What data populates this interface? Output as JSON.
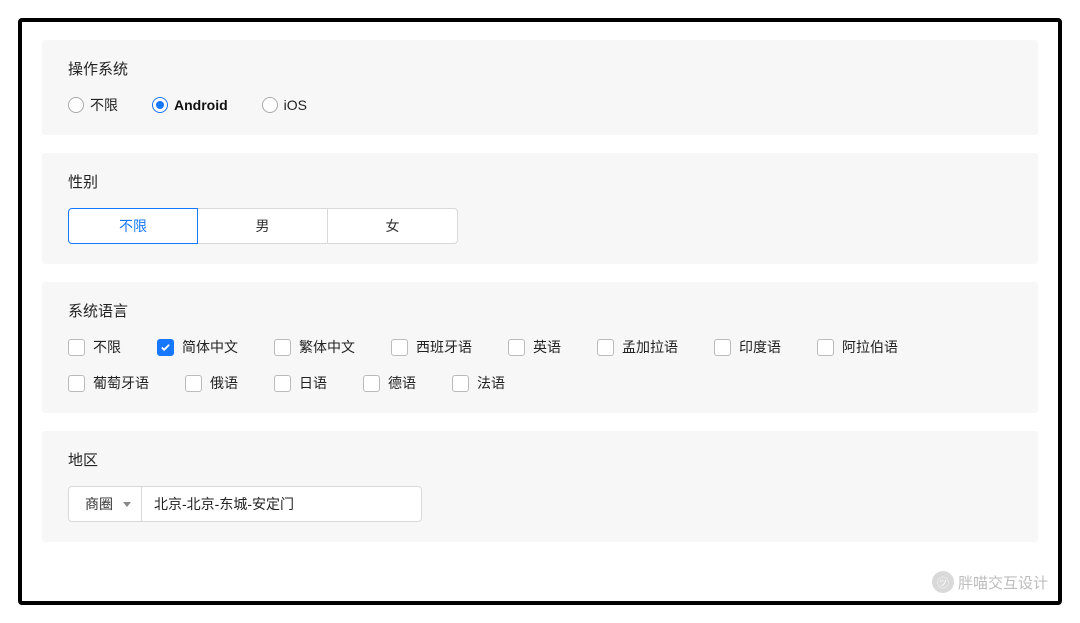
{
  "os": {
    "title": "操作系统",
    "options": [
      {
        "label": "不限",
        "selected": false
      },
      {
        "label": "Android",
        "selected": true
      },
      {
        "label": "iOS",
        "selected": false
      }
    ]
  },
  "gender": {
    "title": "性别",
    "options": [
      {
        "label": "不限",
        "selected": true
      },
      {
        "label": "男",
        "selected": false
      },
      {
        "label": "女",
        "selected": false
      }
    ]
  },
  "language": {
    "title": "系统语言",
    "row1": [
      {
        "label": "不限",
        "checked": false
      },
      {
        "label": "简体中文",
        "checked": true
      },
      {
        "label": "繁体中文",
        "checked": false
      },
      {
        "label": "西班牙语",
        "checked": false
      },
      {
        "label": "英语",
        "checked": false
      },
      {
        "label": "孟加拉语",
        "checked": false
      },
      {
        "label": "印度语",
        "checked": false
      },
      {
        "label": "阿拉伯语",
        "checked": false
      }
    ],
    "row2": [
      {
        "label": "葡萄牙语",
        "checked": false
      },
      {
        "label": "俄语",
        "checked": false
      },
      {
        "label": "日语",
        "checked": false
      },
      {
        "label": "德语",
        "checked": false
      },
      {
        "label": "法语",
        "checked": false
      }
    ]
  },
  "region": {
    "title": "地区",
    "select_label": "商圈",
    "input_value": "北京-北京-东城-安定门"
  },
  "watermark": {
    "text": "胖喵交互设计"
  }
}
